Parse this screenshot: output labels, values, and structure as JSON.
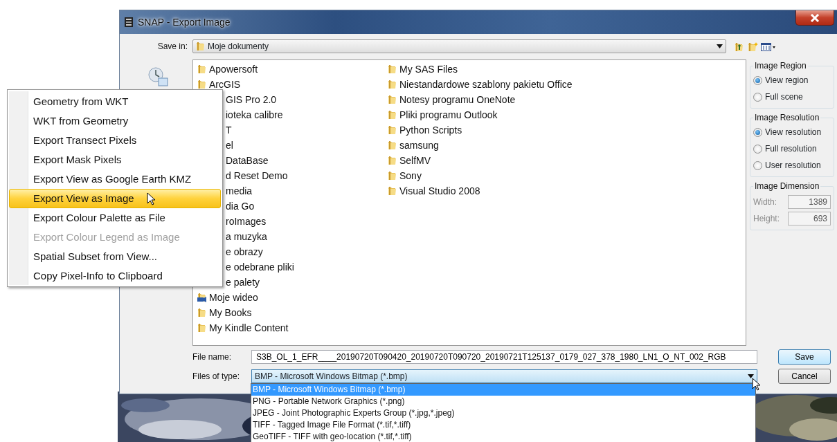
{
  "window": {
    "title": "SNAP - Export Image"
  },
  "save_in": {
    "label": "Save in:",
    "value": "Moje dokumenty"
  },
  "files": {
    "columns": [
      [
        {
          "name": "Apowersoft",
          "kind": "folder"
        },
        {
          "name": "ArcGIS",
          "kind": "folder"
        },
        {
          "name": "GIS Pro 2.0",
          "kind": "covered"
        },
        {
          "name": "ioteka calibre",
          "kind": "covered"
        },
        {
          "name": "T",
          "kind": "covered"
        },
        {
          "name": "el",
          "kind": "covered"
        },
        {
          "name": "DataBase",
          "kind": "covered"
        },
        {
          "name": "d Reset Demo",
          "kind": "covered"
        },
        {
          "name": "media",
          "kind": "covered"
        },
        {
          "name": "dia Go",
          "kind": "covered"
        },
        {
          "name": "roImages",
          "kind": "covered"
        },
        {
          "name": "a muzyka",
          "kind": "covered"
        },
        {
          "name": "e obrazy",
          "kind": "covered"
        },
        {
          "name": "e odebrane pliki",
          "kind": "covered"
        },
        {
          "name": "e palety",
          "kind": "covered"
        },
        {
          "name": "Moje wideo",
          "kind": "video-folder"
        },
        {
          "name": "My Books",
          "kind": "folder"
        },
        {
          "name": "My Kindle Content",
          "kind": "folder"
        }
      ],
      [
        {
          "name": "My SAS Files",
          "kind": "folder"
        },
        {
          "name": "Niestandardowe szablony pakietu Office",
          "kind": "folder"
        },
        {
          "name": "Notesy programu OneNote",
          "kind": "folder"
        },
        {
          "name": "Pliki programu Outlook",
          "kind": "folder"
        },
        {
          "name": "Python Scripts",
          "kind": "folder"
        },
        {
          "name": "samsung",
          "kind": "folder"
        },
        {
          "name": "SelfMV",
          "kind": "folder"
        },
        {
          "name": "Sony",
          "kind": "folder"
        },
        {
          "name": "Visual Studio 2008",
          "kind": "folder"
        }
      ]
    ]
  },
  "groups": [
    {
      "title": "Image Region",
      "options": [
        {
          "label": "View region",
          "selected": true
        },
        {
          "label": "Full scene",
          "selected": false
        }
      ]
    },
    {
      "title": "Image Resolution",
      "options": [
        {
          "label": "View resolution",
          "selected": true
        },
        {
          "label": "Full resolution",
          "selected": false
        },
        {
          "label": "User resolution",
          "selected": false
        }
      ]
    }
  ],
  "dimension": {
    "title": "Image Dimension",
    "disabled": true,
    "fields": [
      {
        "label": "Width:",
        "value": "1389"
      },
      {
        "label": "Height:",
        "value": "693"
      }
    ]
  },
  "file_name": {
    "label": "File name:",
    "value": "S3B_OL_1_EFR____20190720T090420_20190720T090720_20190721T125137_0179_027_378_1980_LN1_O_NT_002_RGB"
  },
  "file_type": {
    "label": "Files of type:",
    "value": "BMP - Microsoft Windows Bitmap (*.bmp)",
    "expanded": true,
    "options": [
      {
        "label": "BMP - Microsoft Windows Bitmap (*.bmp)",
        "selected": true
      },
      {
        "label": "PNG - Portable Network Graphics (*.png)",
        "selected": false
      },
      {
        "label": "JPEG - Joint Photographic Experts Group (*.jpg,*.jpeg)",
        "selected": false
      },
      {
        "label": "TIFF - Tagged Image File Format (*.tif,*.tiff)",
        "selected": false
      },
      {
        "label": "GeoTIFF - TIFF with geo-location (*.tif,*.tiff)",
        "selected": false
      }
    ]
  },
  "buttons": [
    "Save",
    "Cancel"
  ],
  "context_menu": [
    {
      "label": "Geometry from WKT",
      "selected": false,
      "disabled": false
    },
    {
      "label": "WKT from Geometry",
      "selected": false,
      "disabled": false
    },
    {
      "label": "Export Transect Pixels",
      "selected": false,
      "disabled": false
    },
    {
      "label": "Export Mask Pixels",
      "selected": false,
      "disabled": false
    },
    {
      "label": "Export View as Google Earth KMZ",
      "selected": false,
      "disabled": false
    },
    {
      "label": "Export View as Image",
      "selected": true,
      "disabled": false
    },
    {
      "label": "Export Colour Palette as File",
      "selected": false,
      "disabled": false
    },
    {
      "label": "Export Colour Legend as Image",
      "selected": false,
      "disabled": true
    },
    {
      "label": "Spatial Subset from View...",
      "selected": false,
      "disabled": false
    },
    {
      "label": "Copy Pixel-Info to Clipboard",
      "selected": false,
      "disabled": false
    }
  ]
}
